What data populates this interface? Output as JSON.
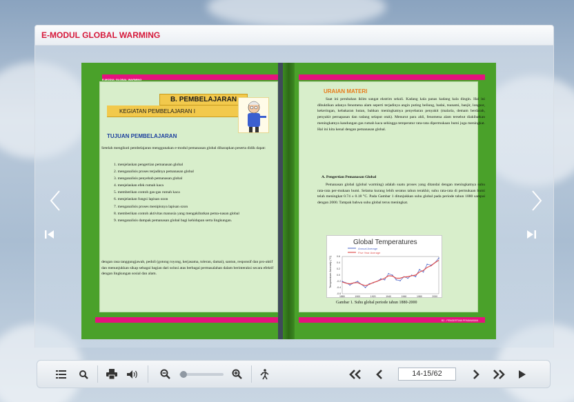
{
  "app": {
    "title": "E-MODUL GLOBAL WARMING"
  },
  "left_page": {
    "running_head": "E-MODUL GLOBAL WARMING",
    "section_title": "B. PEMBELAJARAN",
    "activity_title": "KEGIATAN PEMBELAJARAN I",
    "objectives_heading": "TUJUAN PEMBELAJARAN",
    "intro": "Setelah mengikuti pembelajaran menggunakan e-modul pemanasan global diharapkan peserta didik dapat:",
    "objectives": [
      "1. menjelaskan pengertian pemanasan global",
      "2. menganalisis proses terjadinya pemanasan global",
      "3. menganalisis penyebab pemanasan global",
      "4. menjelaskan efek rumah kaca",
      "5. memberikan contoh gas-gas rumah kaca",
      "6. menjelaskan fungsi lapisan ozon",
      "7. menganalisis proses menipisnya lapisan ozon",
      "8. memberikan contoh aktivitas manusia yang mengakibatkan pema-nasan global",
      "9. menganalisis dampak pemanasan global bagi kehidupan serta lingkungan."
    ],
    "closing": "dengan rasa tanggungjawab, peduli (gotong royong, kerjasama, toleran, damai), santun, responsif dan pro-aktif dan menunjukkan sikap sebagai bagian dari solusi atas berbagai permasalahan dalam berinteraksi secara efektif dengan lingkungan sosial dan alam."
  },
  "right_page": {
    "heading": "URAIAN MATERI",
    "para1": "Saat ini perubahan iklim sangat ekstrim sekali. Kadang kala panas kadang kala dingin. Hal ini dibuktikan adanya fenomena alam seperti terjadinya angin puting beliung, badai, tsunami, banjir, longsor, kekeringan, kebakaran hutan, bahkan meningkatnya penyebaran penyakit (malaria, demam berdarah, penyakit pernapasan dan radang selaput otak). Menurut para ahli, fenomena alam tersebut diakibatkan meningkatnya kandungan gas rumah kaca sehingga temperatur rata-rata dipermukaan bumi juga meningkat. Hal ini kita kenal dengan pemanasan global.",
    "subheading": "A.   Pengertian Pemanasan Global",
    "para2": "Pemanasan global (global warming) adalah suatu proses yang ditandai dengan meningkatnya suhu rata-rata per-mukaan bumi. Selama kurang lebih seratus tahun terakhir, suhu rata-rata di permukaan bumi telah meningkat 0.74 ± 0.18 °C. Pada Gambar 1 ditunjukkan suhu global pada periode tahun 1880 sampai dengan 2000. Tampak bahwa suhu global terus meningkat.",
    "figure_caption": "Gambar 1. Suhu global periode tahun 1880-2000",
    "footer": "B2 - PENGERTIAN PEMANASAN",
    "chart": {
      "title": "Global Temperatures",
      "legend": [
        "Annual Average",
        "Five Year Average"
      ],
      "ylabel": "Temperature Anomaly (°C)",
      "xticks": [
        "1880",
        "1900",
        "1920",
        "1940",
        "1960",
        "1980",
        "2000"
      ],
      "yticks": [
        "0.6",
        "0.4",
        "0.2",
        "0.0",
        "-0.2",
        "-0.4",
        "-0.6"
      ]
    }
  },
  "toolbar": {
    "page_indicator": "14-15/62",
    "icons": [
      "table-of-contents-icon",
      "search-icon",
      "print-icon",
      "sound-icon",
      "zoom-out-icon",
      "zoom-slider",
      "zoom-in-icon",
      "autoflip-icon",
      "first-page-icon",
      "previous-page-icon",
      "next-page-icon",
      "last-page-icon",
      "play-icon"
    ],
    "zoom_level": 0.05
  },
  "colors": {
    "title": "#d6183a",
    "page_green": "#4aa12a",
    "accent_pink": "#e5127d",
    "heading_blue": "#1c3f9e",
    "heading_orange": "#e87a1a"
  },
  "chart_data": {
    "type": "line",
    "title": "Global Temperatures",
    "ylabel": "Temperature Anomaly (°C)",
    "ylim": [
      -0.6,
      0.6
    ],
    "xlim": [
      1880,
      2005
    ],
    "series": [
      {
        "name": "Annual Average",
        "x": [
          1880,
          1885,
          1890,
          1895,
          1900,
          1905,
          1910,
          1915,
          1920,
          1925,
          1930,
          1935,
          1940,
          1945,
          1950,
          1955,
          1960,
          1965,
          1970,
          1975,
          1980,
          1985,
          1990,
          1995,
          2000,
          2005
        ],
        "values": [
          -0.2,
          -0.25,
          -0.32,
          -0.25,
          -0.2,
          -0.3,
          -0.4,
          -0.28,
          -0.25,
          -0.2,
          -0.12,
          -0.15,
          0.05,
          0.0,
          -0.15,
          -0.18,
          -0.05,
          -0.1,
          0.0,
          -0.05,
          0.18,
          0.1,
          0.35,
          0.32,
          0.4,
          0.55
        ]
      },
      {
        "name": "Five Year Average",
        "x": [
          1880,
          1885,
          1890,
          1895,
          1900,
          1905,
          1910,
          1915,
          1920,
          1925,
          1930,
          1935,
          1940,
          1945,
          1950,
          1955,
          1960,
          1965,
          1970,
          1975,
          1980,
          1985,
          1990,
          1995,
          2000,
          2005
        ],
        "values": [
          -0.22,
          -0.26,
          -0.28,
          -0.25,
          -0.24,
          -0.3,
          -0.34,
          -0.3,
          -0.24,
          -0.2,
          -0.15,
          -0.1,
          -0.02,
          -0.03,
          -0.1,
          -0.1,
          -0.06,
          -0.05,
          -0.02,
          0.0,
          0.1,
          0.15,
          0.25,
          0.3,
          0.4,
          0.48
        ]
      }
    ]
  }
}
